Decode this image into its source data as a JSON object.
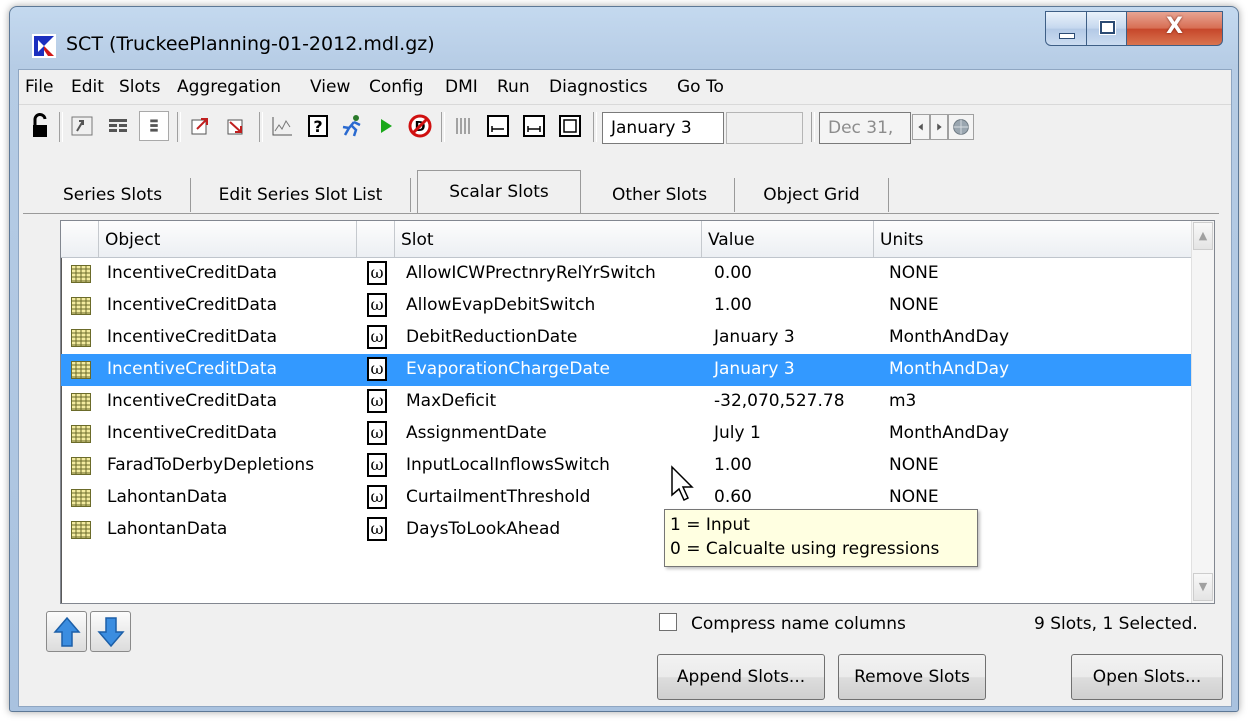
{
  "window": {
    "title": "SCT  (TruckeePlanning-01-2012.mdl.gz)",
    "close_glyph": "X",
    "minimize_icon": "minimize-icon",
    "maximize_icon": "maximize-icon"
  },
  "menu": [
    "File",
    "Edit",
    "Slots",
    "Aggregation",
    "View",
    "Config",
    "DMI",
    "Run",
    "Diagnostics",
    "Go To"
  ],
  "toolbar": {
    "date_field": "January 3",
    "end_date_field": "Dec 31,",
    "icons": [
      "lock-icon",
      "sync-icon",
      "filter-icon",
      "rows-icon",
      "open-slot-icon",
      "close-slot-icon",
      "plot-icon",
      "question-icon",
      "run-figure-icon",
      "play-icon",
      "stop-icon",
      "columns-icon",
      "fit-left-icon",
      "fit-right-icon",
      "fit-all-icon",
      "prev-icon",
      "next-icon",
      "globe-icon"
    ]
  },
  "tabs": [
    "Series Slots",
    "Edit Series Slot List",
    "Scalar Slots",
    "Other Slots",
    "Object Grid"
  ],
  "active_tab": "Scalar Slots",
  "table": {
    "headers": [
      "Object",
      "Slot",
      "Value",
      "Units"
    ],
    "rows": [
      {
        "object": "IncentiveCreditData",
        "slot": "AllowICWPrectnryRelYrSwitch",
        "value": "0.00",
        "units": "NONE",
        "selected": false
      },
      {
        "object": "IncentiveCreditData",
        "slot": "AllowEvapDebitSwitch",
        "value": "1.00",
        "units": "NONE",
        "selected": false
      },
      {
        "object": "IncentiveCreditData",
        "slot": "DebitReductionDate",
        "value": "January 3",
        "units": "MonthAndDay",
        "selected": false
      },
      {
        "object": "IncentiveCreditData",
        "slot": "EvaporationChargeDate",
        "value": "January 3",
        "units": "MonthAndDay",
        "selected": true
      },
      {
        "object": "IncentiveCreditData",
        "slot": "MaxDeficit",
        "value": "-32,070,527.78",
        "units": "m3",
        "selected": false
      },
      {
        "object": "IncentiveCreditData",
        "slot": "AssignmentDate",
        "value": "July 1",
        "units": "MonthAndDay",
        "selected": false
      },
      {
        "object": "FaradToDerbyDepletions",
        "slot": "InputLocalInflowsSwitch",
        "value": "1.00",
        "units": "NONE",
        "selected": false
      },
      {
        "object": "LahontanData",
        "slot": "CurtailmentThreshold",
        "value": "0.60",
        "units": "NONE",
        "selected": false
      },
      {
        "object": "LahontanData",
        "slot": "DaysToLookAhead",
        "value": "",
        "units": "",
        "selected": false
      }
    ],
    "slot_icon_glyph": "ω"
  },
  "tooltip": {
    "line1": "1 = Input",
    "line2": "0 = Calcualte using regressions"
  },
  "footer": {
    "compress_label": "Compress name columns",
    "compress_checked": false,
    "status": "9 Slots, 1 Selected.",
    "append_label": "Append Slots...",
    "remove_label": "Remove Slots",
    "open_label": "Open Slots..."
  },
  "colors": {
    "selection": "#3399ff",
    "tooltip_bg": "#ffffe1",
    "close_button": "#c6462a"
  }
}
